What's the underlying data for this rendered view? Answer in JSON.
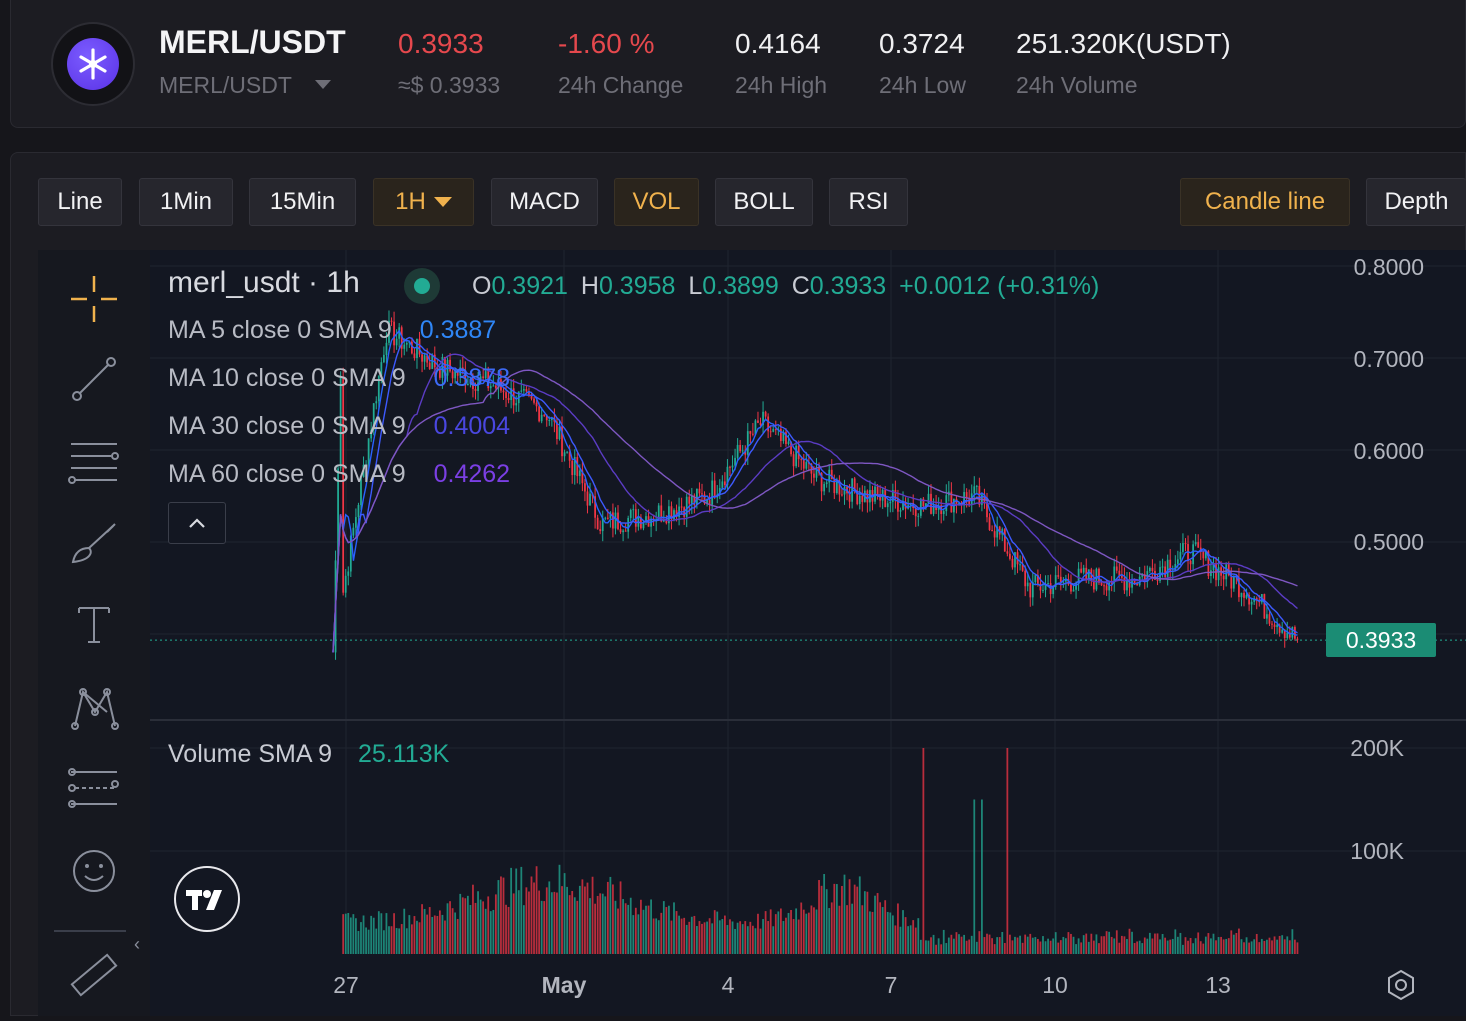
{
  "header": {
    "pair": "MERL/USDT",
    "pair_selector": "MERL/USDT",
    "last_price": "0.3933",
    "usd_price": "≈$ 0.3933",
    "change": "-1.60 %",
    "change_label": "24h Change",
    "high": "0.4164",
    "high_label": "24h High",
    "low": "0.3724",
    "low_label": "24h Low",
    "volume": "251.320K(USDT)",
    "volume_label": "24h Volume"
  },
  "toolbar": {
    "line": "Line",
    "min1": "1Min",
    "min15": "15Min",
    "h1": "1H",
    "macd": "MACD",
    "vol": "VOL",
    "boll": "BOLL",
    "rsi": "RSI",
    "candle": "Candle line",
    "depth": "Depth"
  },
  "legend": {
    "symbol": "merl_usdt · 1h",
    "o_label": "O",
    "o": "0.3921",
    "h_label": "H",
    "h": "0.3958",
    "l_label": "L",
    "l": "0.3899",
    "c_label": "C",
    "c": "0.3933",
    "change": "+0.0012 (+0.31%)",
    "ma5_label": "MA 5 close 0 SMA 9",
    "ma5": "0.3887",
    "ma10_label": "MA 10 close 0 SMA 9",
    "ma10": "0.3878",
    "ma30_label": "MA 30 close 0 SMA 9",
    "ma30": "0.4004",
    "ma60_label": "MA 60 close 0 SMA 9",
    "ma60": "0.4262",
    "volume_label": "Volume SMA 9",
    "volume": "25.113K"
  },
  "price_axis": [
    "0.8000",
    "0.7000",
    "0.6000",
    "0.5000"
  ],
  "price_tag": "0.3933",
  "volume_axis": [
    "200K",
    "100K"
  ],
  "time_axis": [
    "27",
    "May",
    "4",
    "7",
    "10",
    "13"
  ],
  "colors": {
    "up": "#22ab94",
    "down": "#f23645",
    "ma5": "#2962ff",
    "ma10": "#3d5afe",
    "ma30": "#5b3cc4",
    "ma60": "#7e57c2",
    "accent": "#f0b24d"
  },
  "chart_data": {
    "type": "candlestick",
    "interval": "1h",
    "ylim": [
      0.37,
      0.82
    ],
    "x_ticks": [
      "27",
      "May",
      "4",
      "7",
      "10",
      "13"
    ],
    "close_path_points": [
      [
        "Apr 26",
        0.38
      ],
      [
        "Apr 27",
        0.73
      ],
      [
        "Apr 28",
        0.69
      ],
      [
        "Apr 29",
        0.67
      ],
      [
        "Apr 30",
        0.64
      ],
      [
        "May 1",
        0.52
      ],
      [
        "May 2",
        0.53
      ],
      [
        "May 3",
        0.55
      ],
      [
        "May 4",
        0.63
      ],
      [
        "May 5",
        0.57
      ],
      [
        "May 6",
        0.55
      ],
      [
        "May 7",
        0.54
      ],
      [
        "May 8",
        0.55
      ],
      [
        "May 9",
        0.45
      ],
      [
        "May 10",
        0.46
      ],
      [
        "May 11",
        0.46
      ],
      [
        "May 12",
        0.49
      ],
      [
        "May 13",
        0.45
      ],
      [
        "May 14",
        0.3933
      ]
    ],
    "volume_ylim": [
      0,
      200000
    ]
  }
}
